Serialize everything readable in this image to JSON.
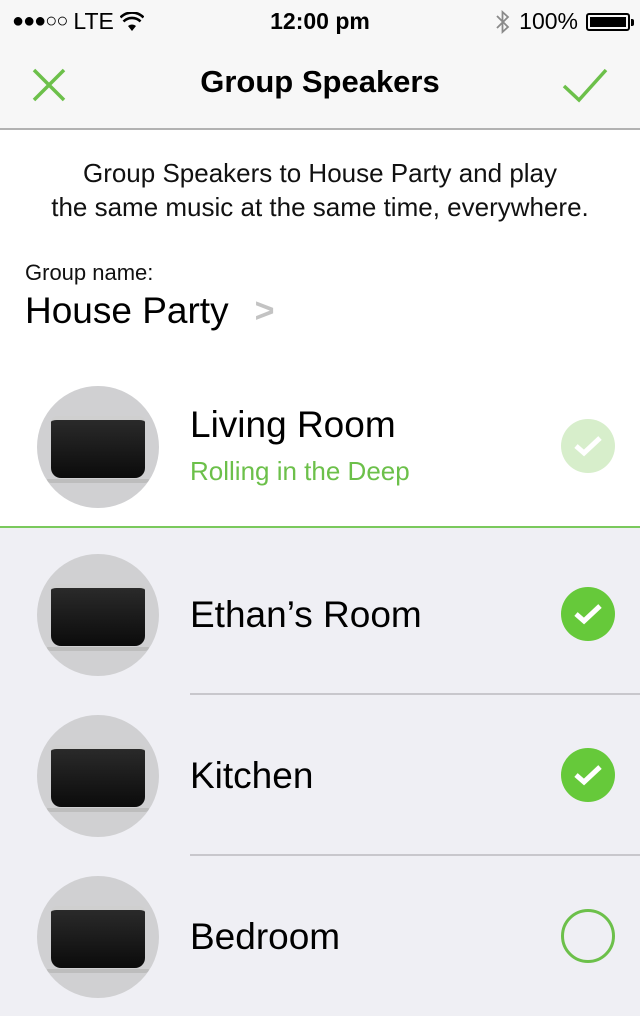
{
  "status_bar": {
    "signal": "●●●○○",
    "carrier": "LTE",
    "time": "12:00 pm",
    "battery": "100%"
  },
  "navbar": {
    "title": "Group Speakers",
    "cancel_icon": "close-icon",
    "done_icon": "checkmark-icon"
  },
  "header": {
    "description_line1": "Group Speakers to House Party and play",
    "description_line2": "the same music at the same time, everywhere.",
    "group_name_label": "Group name:",
    "group_name_value": "House Party"
  },
  "colors": {
    "accent": "#66c93a",
    "accent_light": "#d7eecb",
    "background": "#efeff4"
  },
  "speakers": [
    {
      "name": "Living Room",
      "now_playing": "Rolling in the Deep",
      "state": "host"
    },
    {
      "name": "Ethan’s Room",
      "state": "selected"
    },
    {
      "name": "Kitchen",
      "state": "selected"
    },
    {
      "name": "Bedroom",
      "state": "unselected"
    }
  ]
}
